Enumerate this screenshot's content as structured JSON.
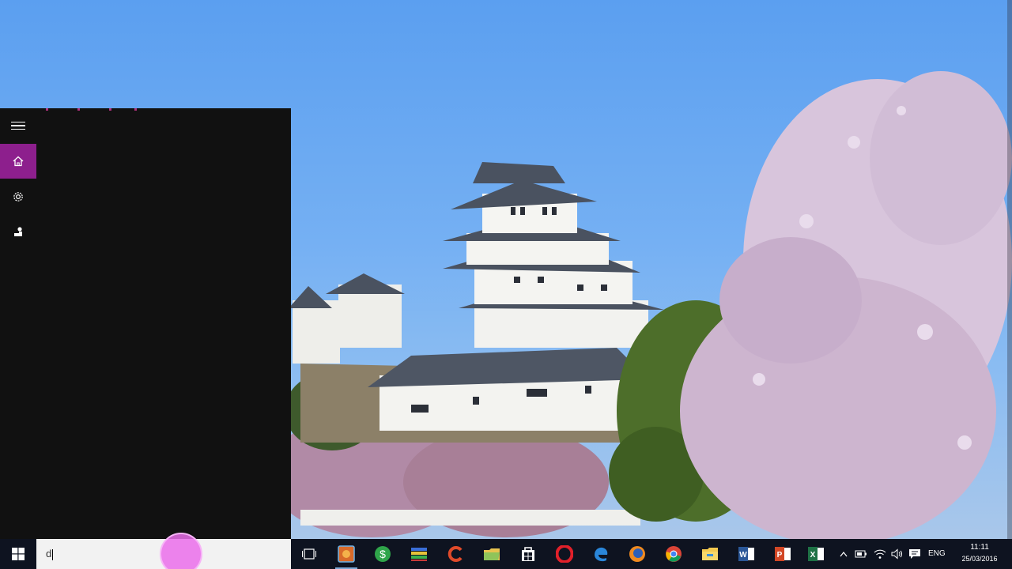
{
  "search": {
    "typed_text": "d"
  },
  "tray": {
    "language": "ENG"
  },
  "clock": {
    "time": "11:11",
    "date": "25/03/2016"
  },
  "start_panel": {
    "rail": [
      {
        "icon": "hamburger-menu-icon"
      },
      {
        "icon": "home-icon",
        "selected": true
      },
      {
        "icon": "settings-gear-icon"
      },
      {
        "icon": "feedback-icon"
      }
    ]
  },
  "taskbar_apps": [
    "task-view-icon",
    "app-icon-orange",
    "money-app-icon",
    "winrar-icon",
    "ccleaner-icon",
    "file-folder-icon",
    "store-icon",
    "opera-icon",
    "edge-icon",
    "firefox-icon",
    "chrome-icon",
    "file-explorer-icon",
    "word-icon",
    "powerpoint-icon",
    "excel-icon"
  ],
  "colors": {
    "accent": "#8d1f8d",
    "taskbar": "#0e1320",
    "panel": "#111111"
  }
}
